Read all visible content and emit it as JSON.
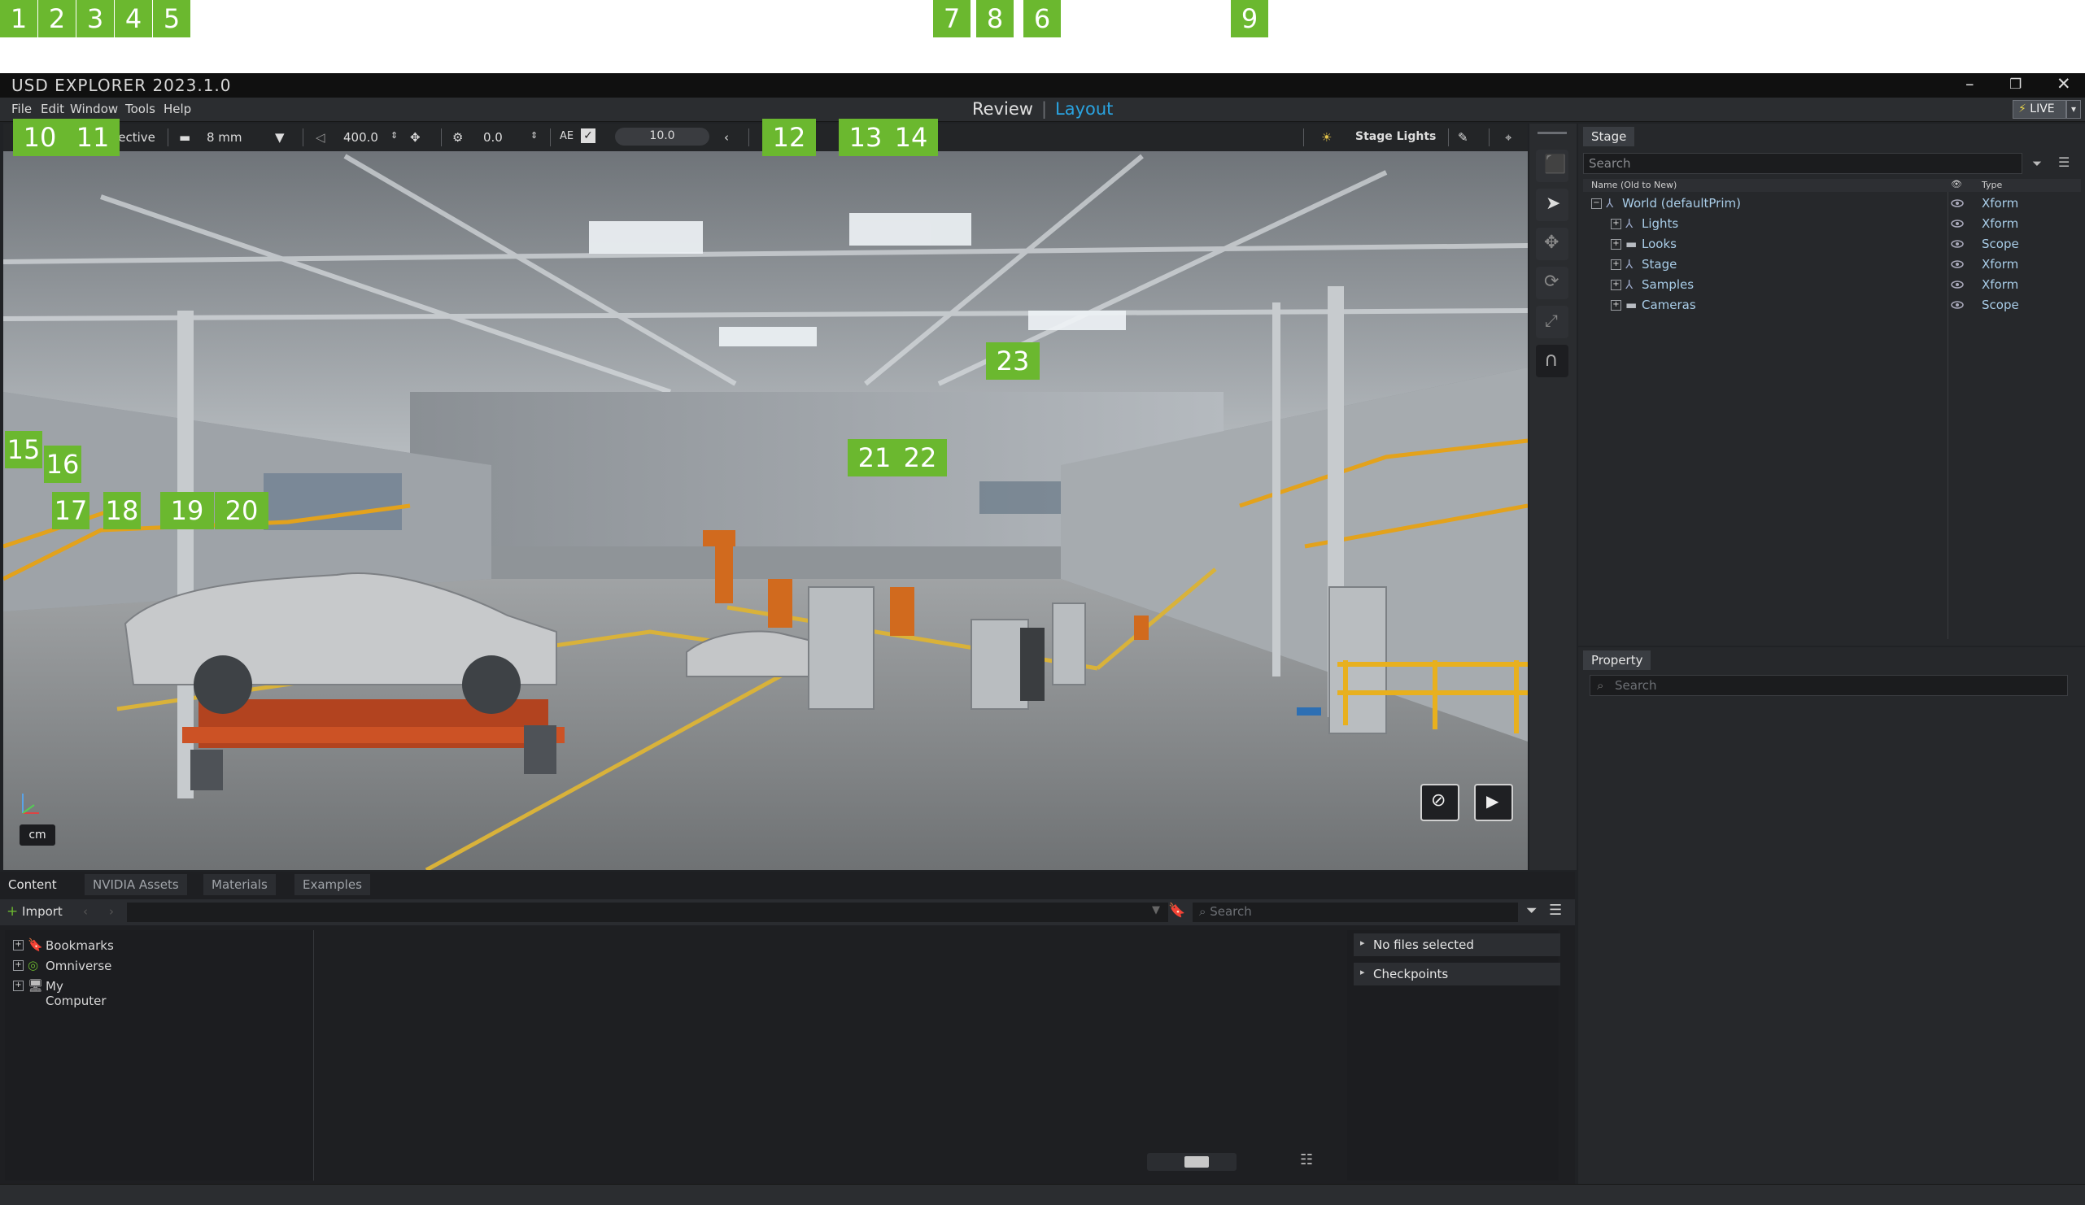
{
  "app": {
    "title": "USD EXPLORER 2023.1.0"
  },
  "menu": [
    "File",
    "Edit",
    "Window",
    "Tools",
    "Help"
  ],
  "modes": {
    "review": "Review",
    "separator": "|",
    "layout": "Layout"
  },
  "live": {
    "label": "LIVE",
    "dropdown": "▾"
  },
  "viewport_toolbar": {
    "camera": "Perspective",
    "focal_length": "8 mm",
    "speed": "400.0",
    "fstop": "0.0",
    "ae_label": "AE",
    "exposure": "10.0",
    "lights": "Stage Lights"
  },
  "units": "cm",
  "stage": {
    "tab": "Stage",
    "search_placeholder": "Search",
    "col_name": "Name (Old to New)",
    "col_type": "Type",
    "items": [
      {
        "name": "World (defaultPrim)",
        "type": "Xform",
        "icon": "xform-icon"
      },
      {
        "name": "Lights",
        "type": "Xform",
        "icon": "xform-icon"
      },
      {
        "name": "Looks",
        "type": "Scope",
        "icon": "folder-icon"
      },
      {
        "name": "Stage",
        "type": "Xform",
        "icon": "xform-icon"
      },
      {
        "name": "Samples",
        "type": "Xform",
        "icon": "xform-icon"
      },
      {
        "name": "Cameras",
        "type": "Scope",
        "icon": "folder-icon"
      }
    ]
  },
  "property": {
    "tab": "Property",
    "search_placeholder": "Search"
  },
  "content": {
    "tabs": [
      "Content",
      "NVIDIA Assets",
      "Materials",
      "Examples"
    ],
    "import_label": "Import",
    "search_placeholder": "Search",
    "tree": [
      "Bookmarks",
      "Omniverse",
      "My Computer"
    ],
    "details": [
      "No files selected",
      "Checkpoints"
    ]
  },
  "callouts": [
    "1",
    "2",
    "3",
    "4",
    "5",
    "6",
    "7",
    "8",
    "9",
    "10",
    "11",
    "12",
    "13",
    "14",
    "15",
    "16",
    "17",
    "18",
    "19",
    "20",
    "21",
    "22",
    "23"
  ],
  "colors": {
    "callout": "#6bb82f",
    "accent": "#2aa3e0",
    "live": "#e8d44a"
  }
}
